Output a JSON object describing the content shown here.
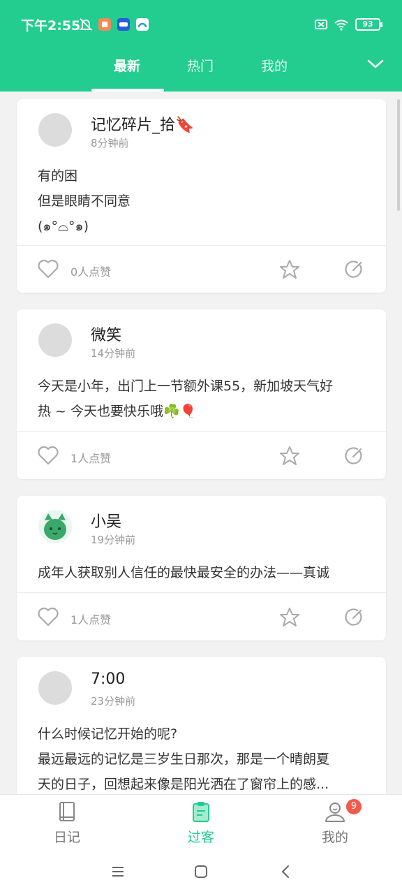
{
  "status": {
    "time": "下午2:55",
    "battery": "93"
  },
  "tabs": [
    {
      "label": "最新",
      "active": true
    },
    {
      "label": "热门",
      "active": false
    },
    {
      "label": "我的",
      "active": false
    }
  ],
  "posts": [
    {
      "author": "记忆碎片_拾🔖",
      "time": "8分钟前",
      "lines": [
        "有的困",
        "但是眼睛不同意",
        "(๑°⌓°๑)"
      ],
      "likes": "0人点赞"
    },
    {
      "author": "微笑",
      "time": "14分钟前",
      "lines": [
        "今天是小年，出门上一节额外课55，新加坡天气好",
        "热 ~ 今天也要快乐哦☘️🎈"
      ],
      "likes": "1人点赞"
    },
    {
      "author": "小吴",
      "time": "19分钟前",
      "lines": [
        "成年人获取别人信任的最快最安全的办法——真诚"
      ],
      "likes": "1人点赞"
    },
    {
      "author": "7:00",
      "time": "23分钟前",
      "lines": [
        "什么时候记忆开始的呢?",
        "最远最远的记忆是三岁生日那次，那是一个晴朗夏",
        "天的日子，回想起来像是阳光洒在了窗帘上的感..."
      ]
    }
  ],
  "bottom_nav": [
    {
      "label": "日记",
      "icon": "book-icon",
      "active": false
    },
    {
      "label": "过客",
      "icon": "clipboard-icon",
      "active": true
    },
    {
      "label": "我的",
      "icon": "user-icon",
      "active": false,
      "badge": "9"
    }
  ],
  "colors": {
    "accent": "#22cd8f",
    "badge": "#f15a4a"
  }
}
